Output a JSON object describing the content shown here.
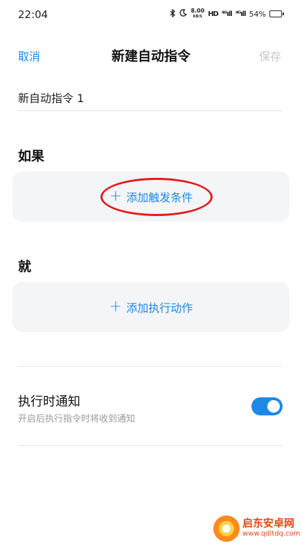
{
  "status_bar": {
    "time": "22:04",
    "speed_value": "8.00",
    "speed_unit": "KB/S",
    "hd_label": "HD",
    "signal_1": "⁴ᴳıll",
    "signal_2": "⁴ᴳıll",
    "battery_percent": "54%",
    "battery_level": 0.54
  },
  "nav": {
    "cancel_label": "取消",
    "title": "新建自动指令",
    "save_label": "保存"
  },
  "name_field": {
    "value": "新自动指令 1"
  },
  "if_section": {
    "label": "如果",
    "add_label": "添加触发条件"
  },
  "then_section": {
    "label": "就",
    "add_label": "添加执行动作"
  },
  "notification": {
    "title": "执行时通知",
    "subtitle": "开启后执行指令时将收到通知",
    "enabled": true
  },
  "watermark": {
    "name": "启东安卓网",
    "url": "www.qdltdq.com"
  },
  "colors": {
    "accent": "#1e88e5",
    "highlight": "#e21b1b",
    "card_bg": "#f4f5f7",
    "disabled_text": "#c8c8c8"
  }
}
